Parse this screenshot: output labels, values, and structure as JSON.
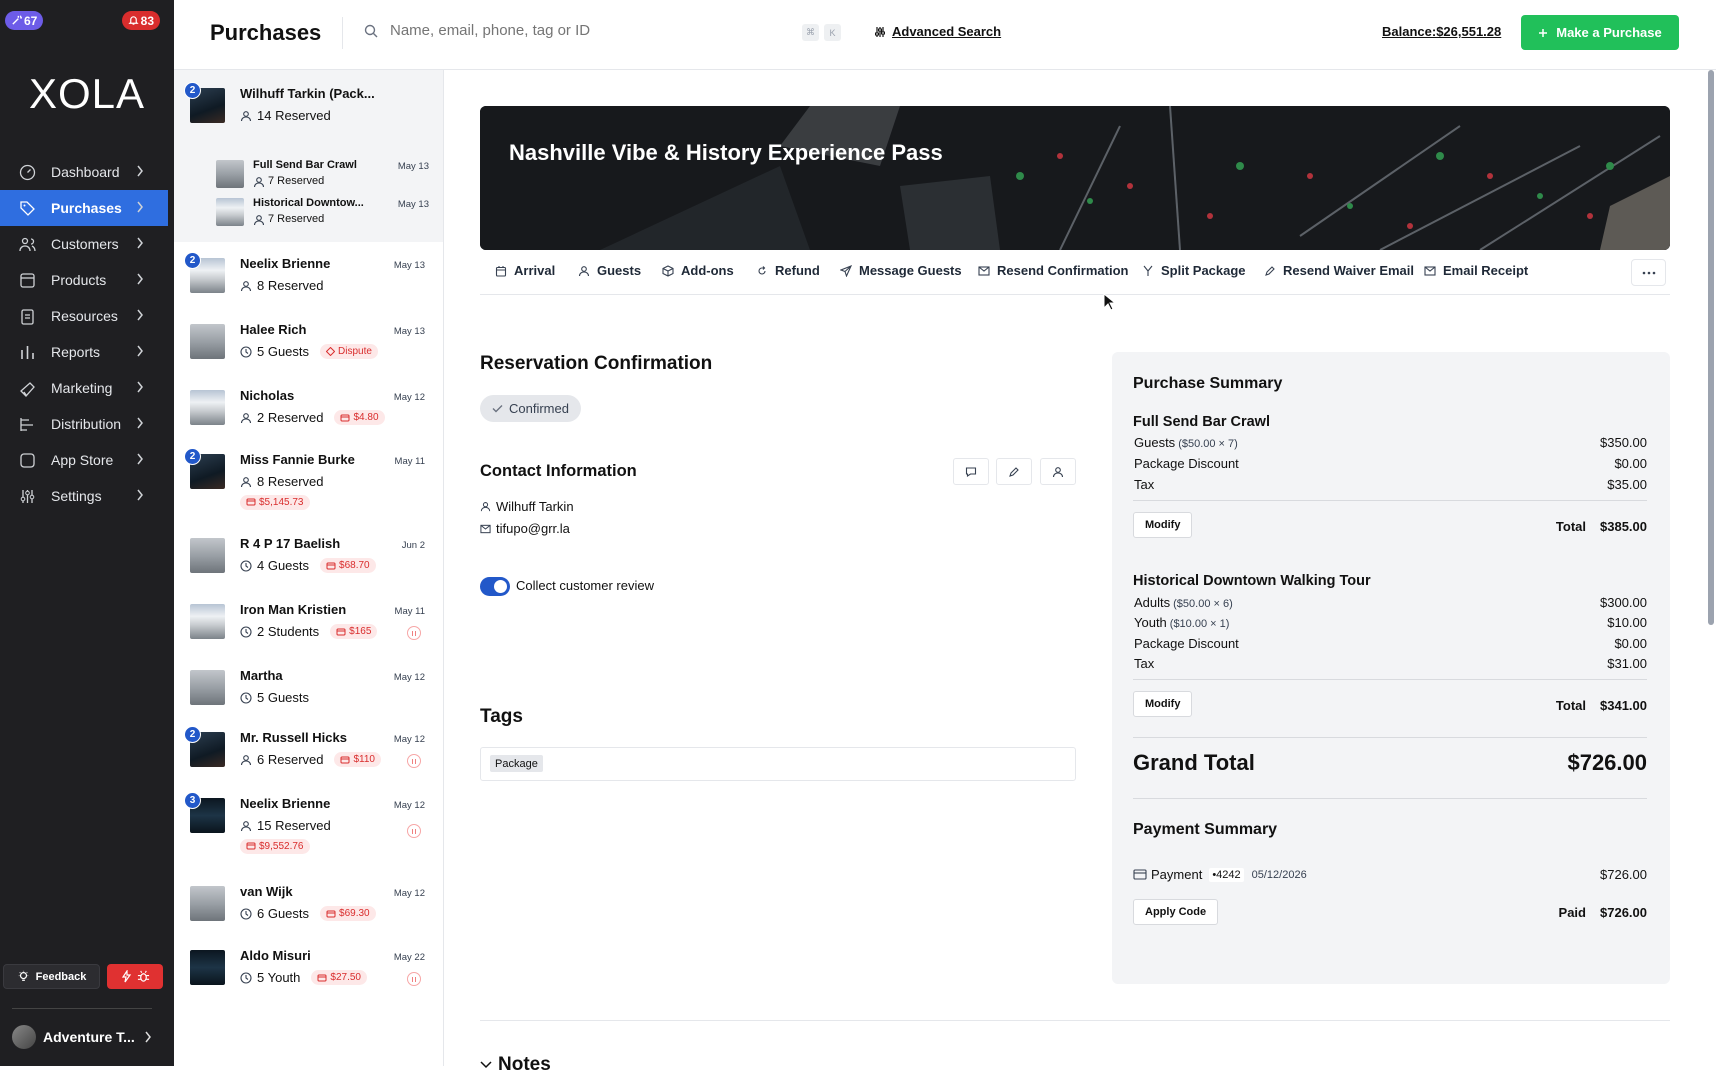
{
  "sidebar": {
    "notif_badge": "67",
    "alert_badge": "83",
    "logo": "XOLA",
    "items": [
      {
        "label": "Dashboard",
        "icon": "dashboard-icon"
      },
      {
        "label": "Purchases",
        "icon": "tag-icon",
        "active": true
      },
      {
        "label": "Customers",
        "icon": "users-icon"
      },
      {
        "label": "Products",
        "icon": "box-icon"
      },
      {
        "label": "Resources",
        "icon": "clipboard-icon"
      },
      {
        "label": "Reports",
        "icon": "bar-chart-icon"
      },
      {
        "label": "Marketing",
        "icon": "megaphone-icon"
      },
      {
        "label": "Distribution",
        "icon": "distribution-icon"
      },
      {
        "label": "App Store",
        "icon": "square-icon"
      },
      {
        "label": "Settings",
        "icon": "sliders-icon"
      }
    ],
    "feedback_label": "Feedback",
    "account_name": "Adventure T..."
  },
  "header": {
    "title": "Purchases",
    "search_placeholder": "Name, email, phone, tag or ID",
    "kbd_1": "⌘",
    "kbd_2": "K",
    "advanced_search": "Advanced Search",
    "balance": "Balance:$26,551.28",
    "make_purchase": "Make a Purchase"
  },
  "purchases": [
    {
      "name": "Wilhuff Tarkin (Pack...",
      "count": "2",
      "sub_icon": "person",
      "sub": "14 Reserved",
      "date": "",
      "selected": true,
      "children": [
        {
          "name": "Full Send Bar Crawl",
          "sub": "7 Reserved",
          "date": "May 13"
        },
        {
          "name": "Historical Downtow...",
          "sub": "7 Reserved",
          "date": "May 13"
        }
      ]
    },
    {
      "name": "Neelix Brienne",
      "count": "2",
      "sub_icon": "person",
      "sub": "8 Reserved",
      "date": "May 13"
    },
    {
      "name": "Halee Rich",
      "sub_icon": "clock",
      "sub": "5 Guests",
      "date": "May 13",
      "tag": "Dispute"
    },
    {
      "name": "Nicholas",
      "sub_icon": "person",
      "sub": "2 Reserved",
      "date": "May 12",
      "amount": "$4.80"
    },
    {
      "name": "Miss Fannie Burke",
      "count": "2",
      "sub_icon": "person",
      "sub": "8 Reserved",
      "date": "May 11",
      "amount_below": "$5,145.73"
    },
    {
      "name": "R 4 P 17 Baelish",
      "sub_icon": "clock",
      "sub": "4 Guests",
      "date": "Jun 2",
      "amount": "$68.70"
    },
    {
      "name": "Iron Man Kristien",
      "sub_icon": "clock",
      "sub": "2 Students",
      "date": "May 11",
      "amount": "$165",
      "paused": true
    },
    {
      "name": "Martha",
      "sub_icon": "clock",
      "sub": "5 Guests",
      "date": "May 12"
    },
    {
      "name": "Mr. Russell Hicks",
      "count": "2",
      "sub_icon": "person",
      "sub": "6 Reserved",
      "date": "May 12",
      "amount": "$110",
      "paused": true
    },
    {
      "name": "Neelix Brienne",
      "count": "3",
      "sub_icon": "person",
      "sub": "15 Reserved",
      "date": "May 12",
      "amount_below": "$9,552.76",
      "paused": true
    },
    {
      "name": "van Wijk",
      "sub_icon": "clock",
      "sub": "6 Guests",
      "date": "May 12",
      "amount": "$69.30"
    },
    {
      "name": "Aldo Misuri",
      "sub_icon": "clock",
      "sub": "5 Youth",
      "date": "May 22",
      "amount": "$27.50",
      "paused": true
    }
  ],
  "detail": {
    "hero_title": "Nashville Vibe & History Experience Pass",
    "tabs": [
      "Arrival",
      "Guests",
      "Add-ons",
      "Refund",
      "Message Guests",
      "Resend Confirmation",
      "Split Package",
      "Resend Waiver Email",
      "Email Receipt"
    ],
    "reservation_title": "Reservation Confirmation",
    "status": "Confirmed",
    "contact_title": "Contact Information",
    "contact_name": "Wilhuff Tarkin",
    "contact_email": "tifupo@grr.la",
    "review_label": "Collect customer review",
    "tags_title": "Tags",
    "tag": "Package",
    "notes_title": "Notes"
  },
  "summary": {
    "title": "Purchase Summary",
    "items": [
      {
        "name": "Full Send Bar Crawl",
        "lines": [
          {
            "label": "Guests",
            "detail": "($50.00 × 7)",
            "amount": "$350.00"
          },
          {
            "label": "Package Discount",
            "detail": "",
            "amount": "$0.00"
          },
          {
            "label": "Tax",
            "detail": "",
            "amount": "$35.00"
          }
        ],
        "modify": "Modify",
        "total_label": "Total",
        "total": "$385.00"
      },
      {
        "name": "Historical Downtown Walking Tour",
        "lines": [
          {
            "label": "Adults",
            "detail": "($50.00 × 6)",
            "amount": "$300.00"
          },
          {
            "label": "Youth",
            "detail": "($10.00 × 1)",
            "amount": "$10.00"
          },
          {
            "label": "Package Discount",
            "detail": "",
            "amount": "$0.00"
          },
          {
            "label": "Tax",
            "detail": "",
            "amount": "$31.00"
          }
        ],
        "modify": "Modify",
        "total_label": "Total",
        "total": "$341.00"
      }
    ],
    "grand_total_label": "Grand Total",
    "grand_total": "$726.00",
    "payment_title": "Payment Summary",
    "payment_label": "Payment",
    "card": "•4242",
    "payment_date": "05/12/2026",
    "payment_amount": "$726.00",
    "apply_code": "Apply Code",
    "paid_label": "Paid",
    "paid_amount": "$726.00"
  },
  "colors": {
    "accent": "#2f6ee0",
    "brand_green": "#21c05a",
    "danger": "#d92d2d",
    "sidebar_bg": "#1f1f22"
  }
}
